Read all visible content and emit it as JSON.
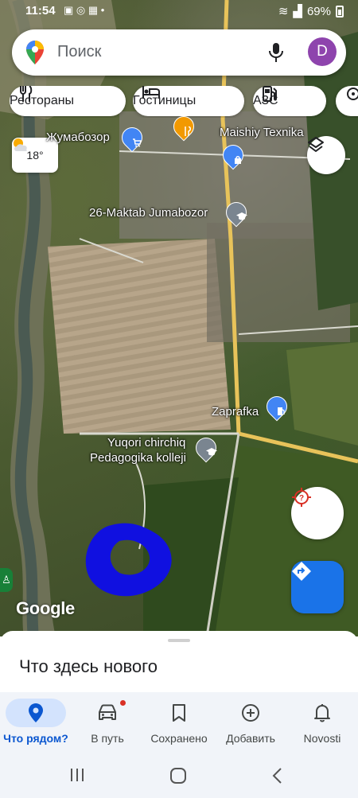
{
  "status_bar": {
    "time": "11:54",
    "battery": "69%"
  },
  "search": {
    "placeholder": "Поиск",
    "avatar_letter": "D"
  },
  "chips": [
    {
      "label": "Рестораны",
      "icon": "fork-knife-icon"
    },
    {
      "label": "Гостиницы",
      "icon": "bed-icon"
    },
    {
      "label": "АЗС",
      "icon": "gas-station-icon"
    }
  ],
  "weather": {
    "temp": "18°",
    "icon": "partly-cloudy-icon"
  },
  "map_labels": {
    "jumabozor": "Жумабозор",
    "maishiy": "Maishiy Texnika",
    "maktab": "26-Maktab Jumabozor",
    "zaprafka": "Zaprafka",
    "kolleji_1": "Yuqori chirchiq",
    "kolleji_2": "Pedagogika kolleji"
  },
  "google_logo": "Google",
  "sheet": {
    "title": "Что здесь нового"
  },
  "bottom_nav": [
    {
      "label": "Что рядом?",
      "icon": "location-pin-icon",
      "active": true
    },
    {
      "label": "В путь",
      "icon": "car-icon",
      "active": false
    },
    {
      "label": "Сохранено",
      "icon": "bookmark-icon",
      "active": false
    },
    {
      "label": "Добавить",
      "icon": "add-circle-icon",
      "active": false
    },
    {
      "label": "Novosti",
      "icon": "bell-icon",
      "active": false
    }
  ],
  "colors": {
    "accent": "#1a73e8",
    "nav_active": "#0b57d0",
    "nav_active_bg": "#d3e3fd",
    "annotation": "#1010e0"
  }
}
